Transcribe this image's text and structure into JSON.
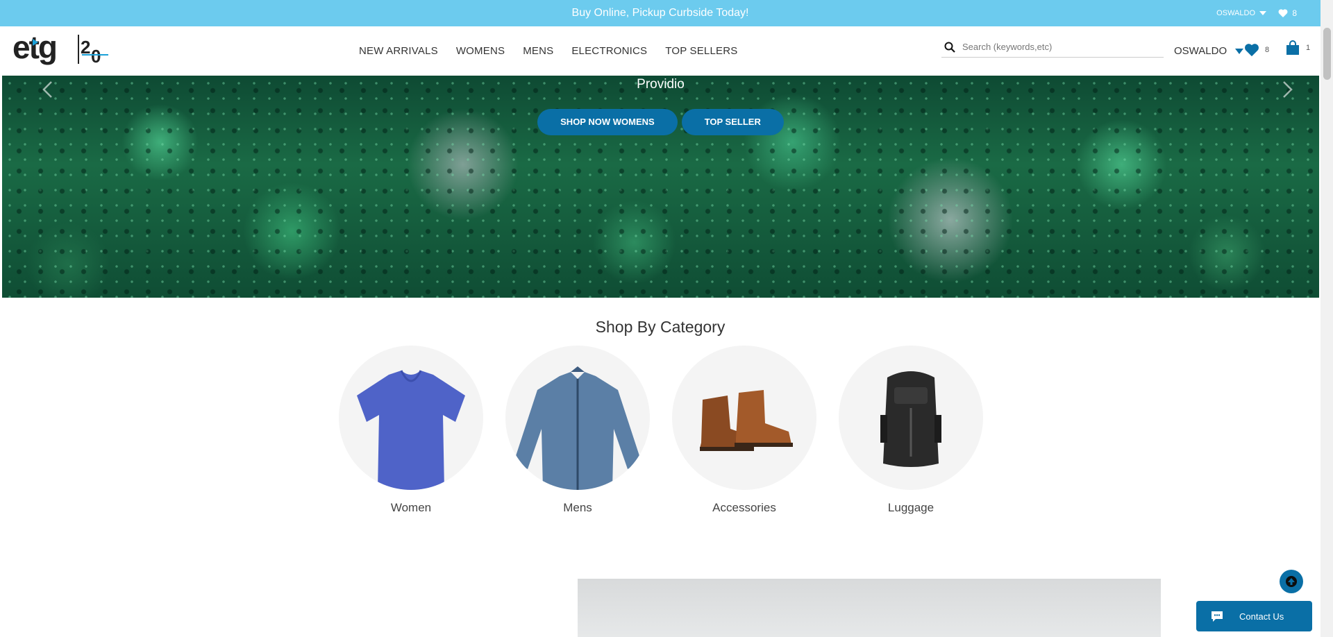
{
  "promo": {
    "message": "Buy Online, Pickup Curbside Today!",
    "user": "OSWALDO",
    "wishlist_count": "8"
  },
  "header": {
    "nav": [
      "NEW ARRIVALS",
      "WOMENS",
      "MENS",
      "ELECTRONICS",
      "TOP SELLERS"
    ],
    "search_placeholder": "Search (keywords,etc)",
    "account_name": "OSWALDO",
    "wishlist_count": "8",
    "cart_count": "1"
  },
  "hero": {
    "title": "Providio",
    "buttons": [
      "SHOP NOW WOMENS",
      "TOP SELLER"
    ]
  },
  "categories": {
    "title": "Shop By Category",
    "items": [
      "Women",
      "Mens",
      "Accessories",
      "Luggage"
    ]
  },
  "contact": {
    "label": "Contact Us"
  },
  "colors": {
    "promo": "#6ccbee",
    "brand_blue": "#0a6fa6"
  },
  "icons": [
    "search-icon",
    "heart-icon",
    "shopping-bag-icon",
    "caret-down-icon",
    "chevron-left-icon",
    "chevron-right-icon",
    "arrow-up-icon",
    "chat-icon"
  ]
}
